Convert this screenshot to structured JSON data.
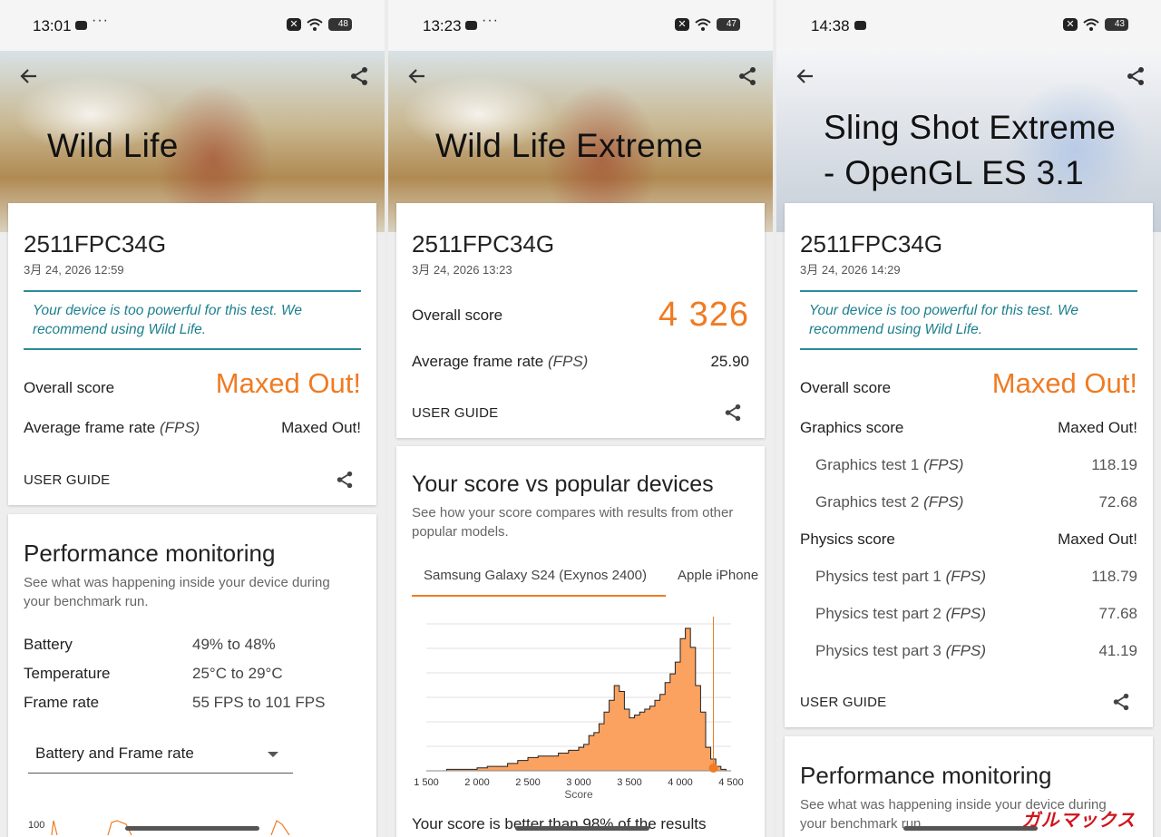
{
  "panels": [
    {
      "status": {
        "time": "13:01",
        "dots": "···",
        "battery": "48"
      },
      "hero_title": "Wild Life",
      "device_name": "2511FPC34G",
      "date": "3月 24, 2026 12:59",
      "note": "Your device is too powerful for this test. We recommend using Wild Life.",
      "overall_label": "Overall score",
      "overall_value": "Maxed Out!",
      "avg_label": "Average frame rate",
      "avg_unit": "(FPS)",
      "avg_value": "Maxed Out!",
      "user_guide": "USER GUIDE",
      "perf": {
        "title": "Performance monitoring",
        "desc": "See what was happening inside your device during your benchmark run.",
        "rows": [
          {
            "label": "Battery",
            "value": "49% to 48%"
          },
          {
            "label": "Temperature",
            "value": "25°C to 29°C"
          },
          {
            "label": "Frame rate",
            "value": "55 FPS to 101 FPS"
          }
        ],
        "dropdown": "Battery and Frame rate",
        "mini_axis": "100"
      }
    },
    {
      "status": {
        "time": "13:23",
        "dots": "···",
        "battery": "47"
      },
      "hero_title": "Wild Life Extreme",
      "device_name": "2511FPC34G",
      "date": "3月 24, 2026 13:23",
      "overall_label": "Overall score",
      "overall_value": "4 326",
      "avg_label": "Average frame rate",
      "avg_unit": "(FPS)",
      "avg_value": "25.90",
      "user_guide": "USER GUIDE",
      "compare": {
        "title": "Your score vs popular devices",
        "desc": "See how your score compares with results from other popular models.",
        "tabs": [
          "Samsung Galaxy S24 (Exynos 2400)",
          "Apple iPhone"
        ],
        "footer": "Your score is better than 98% of the results"
      }
    },
    {
      "status": {
        "time": "14:38",
        "dots": "",
        "battery": "43"
      },
      "hero_title_line1": "Sling Shot Extreme",
      "hero_title_line2": "- OpenGL ES 3.1",
      "device_name": "2511FPC34G",
      "date": "3月 24, 2026 14:29",
      "note": "Your device is too powerful for this test. We recommend using Wild Life.",
      "overall_label": "Overall score",
      "overall_value": "Maxed Out!",
      "rows": [
        {
          "label": "Graphics score",
          "unit": "",
          "value": "Maxed Out!",
          "indent": false
        },
        {
          "label": "Graphics test 1",
          "unit": "(FPS)",
          "value": "118.19",
          "indent": true
        },
        {
          "label": "Graphics test 2",
          "unit": "(FPS)",
          "value": "72.68",
          "indent": true
        },
        {
          "label": "Physics score",
          "unit": "",
          "value": "Maxed Out!",
          "indent": false
        },
        {
          "label": "Physics test part 1",
          "unit": "(FPS)",
          "value": "118.79",
          "indent": true
        },
        {
          "label": "Physics test part 2",
          "unit": "(FPS)",
          "value": "77.68",
          "indent": true
        },
        {
          "label": "Physics test part 3",
          "unit": "(FPS)",
          "value": "41.19",
          "indent": true
        }
      ],
      "user_guide": "USER GUIDE",
      "perf": {
        "title": "Performance monitoring",
        "desc": "See what was happening inside your device during your benchmark run."
      }
    }
  ],
  "chart_data": {
    "type": "area",
    "title": "",
    "xlabel": "Score",
    "ylabel": "",
    "xlim": [
      1500,
      4500
    ],
    "tick_labels": [
      "1 500",
      "2 000",
      "2 500",
      "3 000",
      "3 500",
      "4 000",
      "4 500"
    ],
    "ticks": [
      1500,
      2000,
      2500,
      3000,
      3500,
      4000,
      4500
    ],
    "grid": true,
    "highlight_x": 4326,
    "x": [
      1500,
      1700,
      1900,
      2000,
      2100,
      2200,
      2300,
      2400,
      2500,
      2600,
      2700,
      2800,
      2900,
      3000,
      3050,
      3100,
      3150,
      3200,
      3250,
      3300,
      3350,
      3400,
      3450,
      3500,
      3550,
      3600,
      3650,
      3700,
      3750,
      3800,
      3850,
      3900,
      3950,
      4000,
      4050,
      4100,
      4150,
      4200,
      4250,
      4300,
      4350,
      4400
    ],
    "values": [
      0,
      1,
      1,
      2,
      3,
      3,
      5,
      7,
      9,
      10,
      10,
      12,
      14,
      16,
      18,
      24,
      26,
      32,
      40,
      48,
      58,
      54,
      42,
      36,
      38,
      40,
      42,
      44,
      48,
      52,
      60,
      66,
      74,
      90,
      97,
      84,
      58,
      40,
      16,
      8,
      3,
      1
    ],
    "colors": {
      "fill": "#fba261",
      "stroke": "#222222",
      "marker": "#ef7b23"
    },
    "watermark": "ガルマックス"
  }
}
